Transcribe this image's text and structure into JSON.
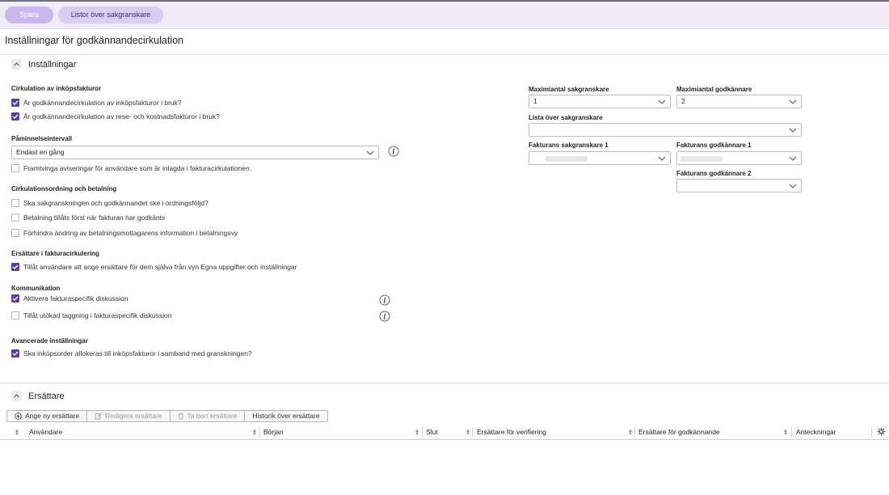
{
  "toolbar": {
    "save_label": "Spara",
    "lists_label": "Listor över sakgranskare"
  },
  "page": {
    "title": "Inställningar för godkännandecirkulation"
  },
  "settings": {
    "title": "Inställningar",
    "groups": {
      "circulation": {
        "title": "Cirkulation av inköpsfakturor",
        "items": [
          {
            "label": "Är godkännandecirkulation av inköpsfakturor i bruk?",
            "checked": true
          },
          {
            "label": "Är godkännandecirkulation av rese- och kostnadsfakturor i bruk?",
            "checked": true
          }
        ]
      },
      "reminder": {
        "title": "Påminnelseintervall",
        "select_value": "Endast en gång",
        "items": [
          {
            "label": "Framtvinga aviseringar för användare som är inlagda i fakturacirkulationen.",
            "checked": false
          }
        ]
      },
      "order": {
        "title": "Cirkulationsordning och betalning",
        "items": [
          {
            "label": "Ska sakgranskningen och godkännandet ske i ordningsföljd?",
            "checked": false
          },
          {
            "label": "Betalning tillåts först när fakturan har godkänts",
            "checked": false
          },
          {
            "label": "Förhindra ändring av betalningsmottagarens information i betalningsvy",
            "checked": false
          }
        ]
      },
      "substitutes": {
        "title": "Ersättare i fakturacirkulering",
        "items": [
          {
            "label": "Tillåt användare att ange ersättare för dem själva från vyn Egna uppgifter och inställningar",
            "checked": true
          }
        ]
      },
      "communication": {
        "title": "Kommunikation",
        "items": [
          {
            "label": "Aktivera fakturaspecifik diskussion",
            "checked": true
          },
          {
            "label": "Tillåt utökad taggning i fakturaspecifik diskussion",
            "checked": false
          }
        ]
      },
      "advanced": {
        "title": "Avancerade inställningar",
        "items": [
          {
            "label": "Ska inköpsorder allokeras till inköpsfakturor i samband med granskningen?",
            "checked": true
          }
        ]
      }
    },
    "right": {
      "max_reviewers_label": "Maximiantal sakgranskare",
      "max_reviewers_value": "1",
      "max_approvers_label": "Maximiantal godkännare",
      "max_approvers_value": "2",
      "reviewer_list_label": "Lista över sakgranskare",
      "reviewer_list_value": "",
      "invoice_reviewer1_label": "Fakturans sakgranskare 1",
      "invoice_approver1_label": "Fakturans godkännare 1",
      "invoice_approver2_label": "Fakturans godkännare 2",
      "invoice_approver2_value": ""
    }
  },
  "substitutes_section": {
    "title": "Ersättare",
    "toolbar": {
      "add": "Ange ny ersättare",
      "edit": "Redigera ersättare",
      "delete": "Ta bort ersättare",
      "history": "Historik över ersättare"
    },
    "columns": [
      "Användare",
      "Början",
      "Slut",
      "Ersättare för verifiering",
      "Ersättare för godkännande",
      "Anteckningar"
    ]
  },
  "colors": {
    "accent": "#5a3ea3",
    "primary_button": "#c8b8ec",
    "secondary_button": "#d8cdf3",
    "topbar": "#efecf7"
  }
}
